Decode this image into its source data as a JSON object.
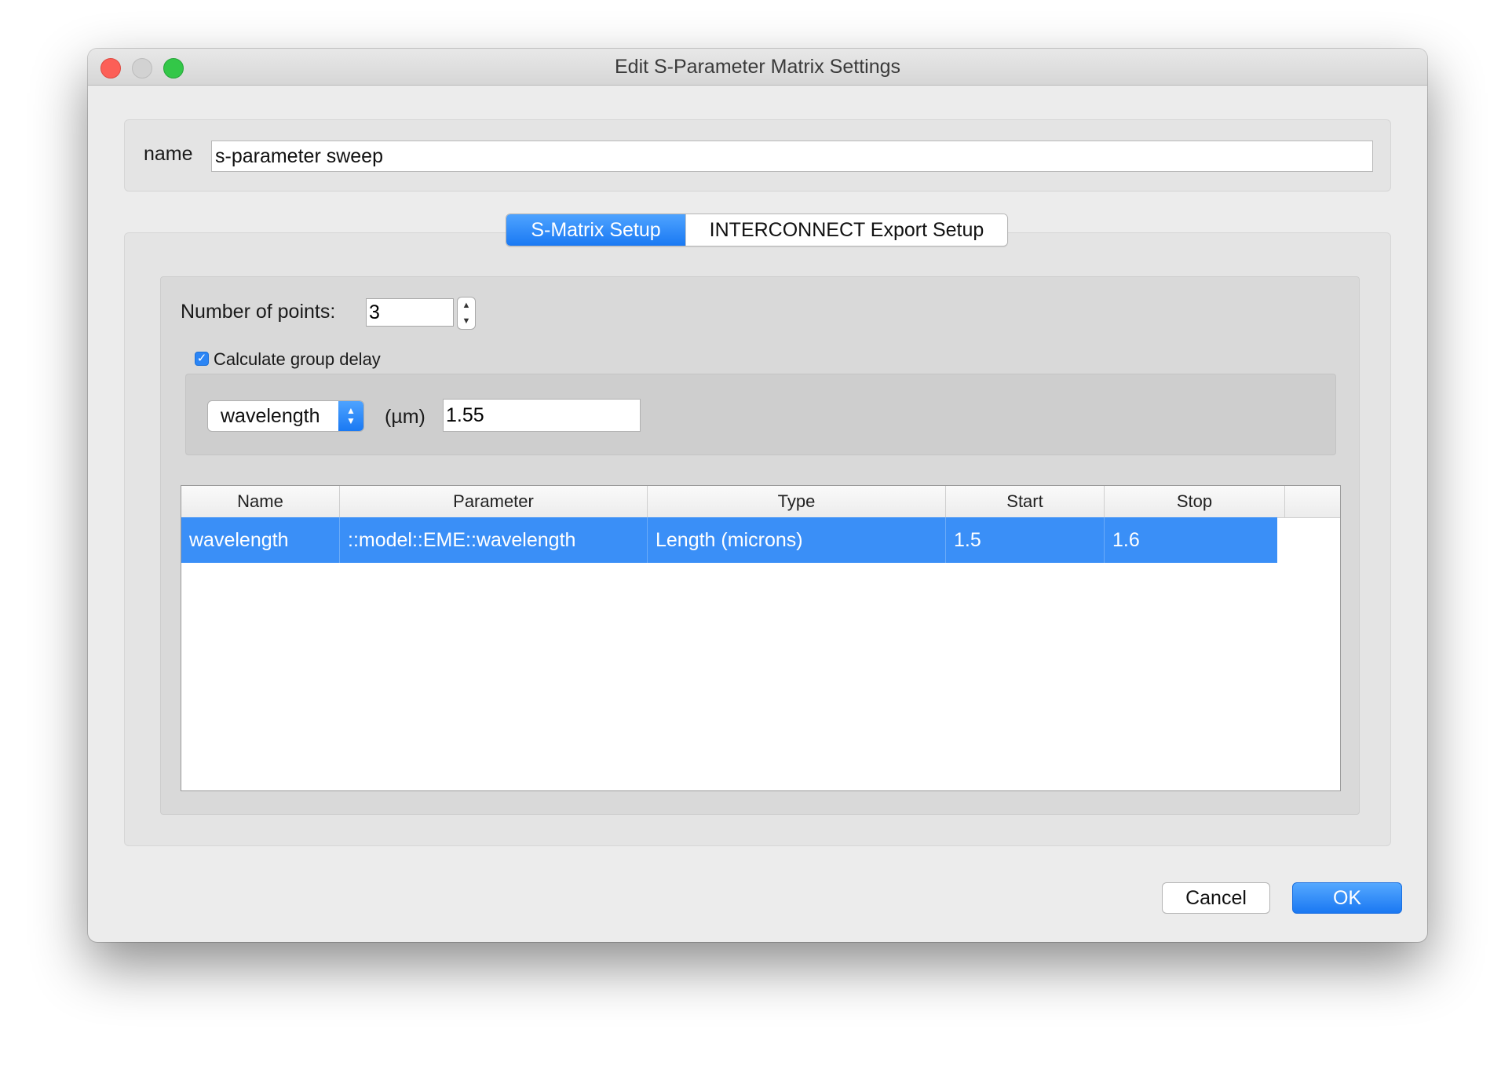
{
  "window": {
    "title": "Edit S-Parameter Matrix Settings"
  },
  "name_field": {
    "label": "name",
    "value": "s-parameter sweep"
  },
  "tabs": [
    {
      "label": "S-Matrix Setup",
      "active": true
    },
    {
      "label": "INTERCONNECT Export Setup",
      "active": false
    }
  ],
  "points": {
    "label": "Number of points:",
    "value": "3"
  },
  "group_delay": {
    "label": "Calculate group delay",
    "checked": true,
    "select_value": "wavelength",
    "unit": "(µm)",
    "value": "1.55"
  },
  "table": {
    "columns": [
      "Name",
      "Parameter",
      "Type",
      "Start",
      "Stop"
    ],
    "rows": [
      [
        "wavelength",
        "::model::EME::wavelength",
        "Length (microns)",
        "1.5",
        "1.6"
      ]
    ]
  },
  "buttons": {
    "cancel": "Cancel",
    "ok": "OK"
  },
  "colors": {
    "accent": "#1a79f3",
    "selection": "#3a8ff7"
  }
}
